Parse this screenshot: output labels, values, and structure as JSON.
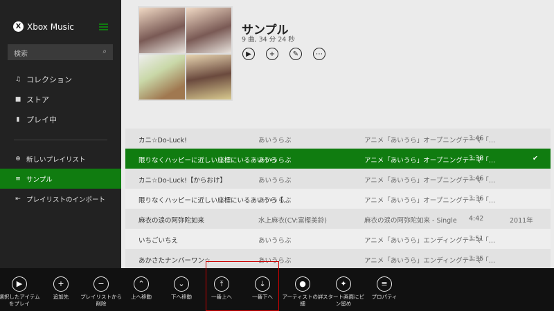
{
  "app": {
    "title": "Xbox Music",
    "search_placeholder": "検索"
  },
  "sidebar": {
    "items": [
      {
        "label": "コレクション",
        "icon": "music-note-icon"
      },
      {
        "label": "ストア",
        "icon": "store-icon"
      },
      {
        "label": "プレイ中",
        "icon": "now-playing-icon"
      }
    ],
    "playlists": [
      {
        "label": "新しいプレイリスト",
        "icon": "add-circle-icon"
      },
      {
        "label": "サンプル",
        "icon": "playlist-icon",
        "selected": true
      },
      {
        "label": "プレイリストのインポート",
        "icon": "import-icon"
      }
    ]
  },
  "playlist": {
    "title": "サンプル",
    "meta": "9 曲, 34 分 24 秒"
  },
  "tracks": [
    {
      "title": "カニ☆Do-Luck!",
      "artist": "あいうらぶ",
      "album": "アニメ「あいうら」オープニングテーマ「…",
      "duration": "3:46",
      "year": ""
    },
    {
      "title": "限りなくハッピーに近しい座標にいるあいうら",
      "artist": "あいうらぶ",
      "album": "アニメ「あいうら」オープニングテーマ「…",
      "duration": "3:38",
      "year": "",
      "selected": true
    },
    {
      "title": "カニ☆Do-Luck!【からおけ】",
      "artist": "あいうらぶ",
      "album": "アニメ「あいうら」オープニングテーマ「…",
      "duration": "3:46",
      "year": ""
    },
    {
      "title": "限りなくハッピーに近しい座標にいるあいうら【…",
      "artist": "あいうらぶ",
      "album": "アニメ「あいうら」オープニングテーマ「…",
      "duration": "3:36",
      "year": ""
    },
    {
      "title": "麻衣の涙の阿弥陀如来",
      "artist": "水上麻衣(CV:富樫美鈴)",
      "album": "麻衣の涙の阿弥陀如来 - Single",
      "duration": "4:42",
      "year": "2011年"
    },
    {
      "title": "いちごいちえ",
      "artist": "あいうらぶ",
      "album": "アニメ「あいうら」エンディングテーマ「…",
      "duration": "3:51",
      "year": ""
    },
    {
      "title": "あかさたナンバーワン☆",
      "artist": "あいうらぶ",
      "album": "アニメ「あいうら」エンディングテーマ「…",
      "duration": "3:35",
      "year": ""
    }
  ],
  "appbar": [
    {
      "label": "選択したアイテムをプレイ",
      "icon": "play-icon"
    },
    {
      "label": "追加先",
      "icon": "add-icon"
    },
    {
      "label": "プレイリストから削除",
      "icon": "remove-icon"
    },
    {
      "label": "上へ移動",
      "icon": "move-up-icon"
    },
    {
      "label": "下へ移動",
      "icon": "move-down-icon"
    },
    {
      "label": "一番上へ",
      "icon": "move-top-icon"
    },
    {
      "label": "一番下へ",
      "icon": "move-bottom-icon"
    },
    {
      "label": "アーティストの詳細",
      "icon": "artist-icon"
    },
    {
      "label": "スタート画面にピン留め",
      "icon": "pin-icon"
    },
    {
      "label": "プロパティ",
      "icon": "properties-icon"
    }
  ],
  "colors": {
    "accent": "#107c10",
    "sidebar": "#222222",
    "appbar": "#111111"
  }
}
